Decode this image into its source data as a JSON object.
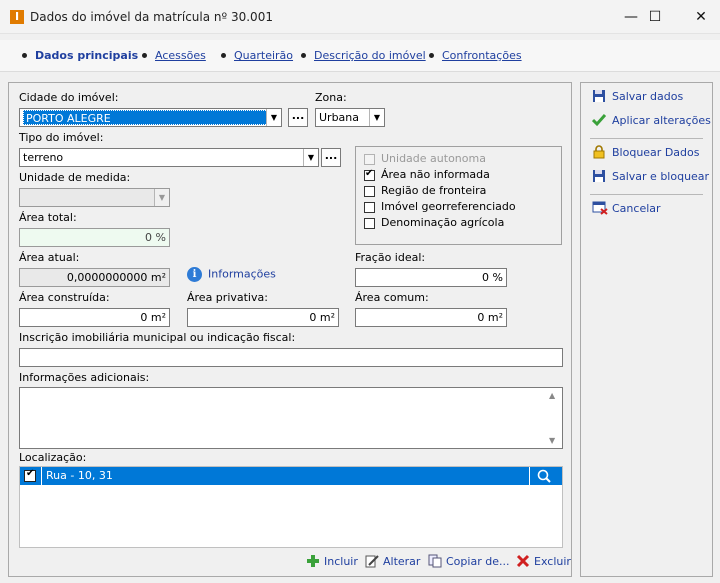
{
  "window": {
    "title": "Dados do imóvel da matrícula nº 30.001",
    "app_icon": "I",
    "minimize_label": "—",
    "maximize_label": "☐",
    "close_label": "✕"
  },
  "tabs": [
    {
      "label": "Dados principais",
      "active": true
    },
    {
      "label": "Acessões"
    },
    {
      "label": "Quarteirão"
    },
    {
      "label": "Descrição do imóvel"
    },
    {
      "label": "Confrontações"
    }
  ],
  "form": {
    "cidade": {
      "label": "Cidade do imóvel:",
      "value": "PORTO ALEGRE"
    },
    "zona": {
      "label": "Zona:",
      "value": "Urbana"
    },
    "tipo": {
      "label": "Tipo do imóvel:",
      "value": "terreno"
    },
    "unidade_medida": {
      "label": "Unidade de medida:",
      "value": ""
    },
    "area_total": {
      "label": "Área total:",
      "value": "0 %"
    },
    "area_atual": {
      "label": "Área atual:",
      "value": "0,0000000000 m²"
    },
    "informacoes_link": "Informações",
    "fracao_ideal": {
      "label": "Fração ideal:",
      "value": "0 %"
    },
    "area_construida": {
      "label": "Área construída:",
      "value": "0 m²"
    },
    "area_privativa": {
      "label": "Área privativa:",
      "value": "0 m²"
    },
    "area_comum": {
      "label": "Área comum:",
      "value": "0 m²"
    },
    "inscricao": {
      "label": "Inscrição imobiliária municipal ou indicação fiscal:",
      "value": ""
    },
    "informacoes_adicionais": {
      "label": "Informações adicionais:",
      "value": ""
    },
    "localizacao": {
      "label": "Localização:",
      "rows": [
        {
          "text": "Rua - 10, 31",
          "checked": true
        }
      ]
    }
  },
  "checkboxes": [
    {
      "label": "Unidade autonoma",
      "checked": false,
      "disabled": true
    },
    {
      "label": "Área não informada",
      "checked": true
    },
    {
      "label": "Região de fronteira",
      "checked": false
    },
    {
      "label": "Imóvel georreferenciado",
      "checked": false
    },
    {
      "label": "Denominação agrícola",
      "checked": false
    }
  ],
  "list_actions": {
    "incluir": "Incluir",
    "alterar": "Alterar",
    "copiar": "Copiar de...",
    "excluir": "Excluir"
  },
  "side_actions": {
    "salvar_dados": "Salvar dados",
    "aplicar": "Aplicar alterações",
    "bloquear": "Bloquear Dados",
    "salvar_bloquear": "Salvar e bloquear",
    "cancelar": "Cancelar"
  },
  "ellipsis": "...",
  "colors": {
    "accent": "#0078d7",
    "link": "#1f3f9f",
    "app_icon": "#e07b00"
  }
}
